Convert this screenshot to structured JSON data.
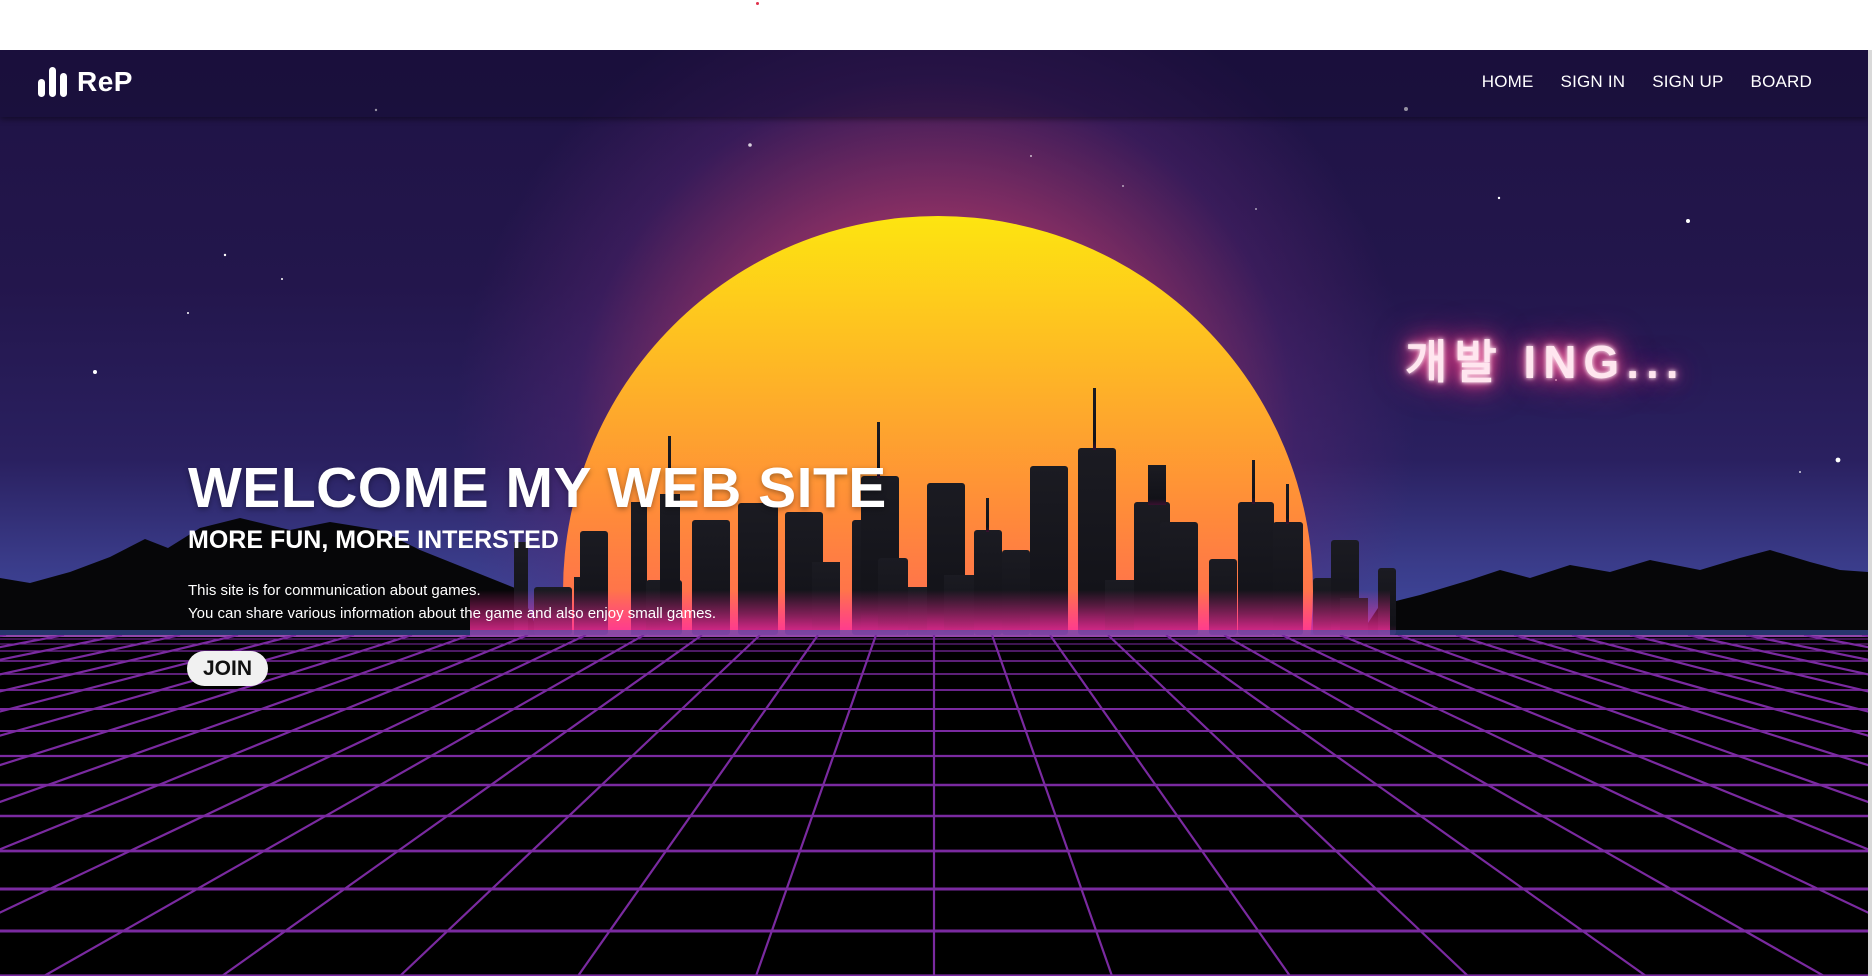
{
  "navbar": {
    "brand": "ReP",
    "links": [
      "HOME",
      "SIGN IN",
      "SIGN UP",
      "BOARD"
    ]
  },
  "neon_sign": "개발 ING...",
  "hero": {
    "title": "WELCOME MY WEB SITE",
    "subtitle": "MORE FUN, MORE INTERSTED",
    "description_line1": "This site is for communication about games.",
    "description_line2": "You can share various information about the game and also enjoy small games.",
    "join_label": "JOIN"
  },
  "colors": {
    "sky_top": "#1f1345",
    "sky_horizon": "#3f4aa0",
    "sun_top": "#fde510",
    "sun_middle": "#ff7a3f",
    "sun_bottom": "#ff1a8e",
    "grid_line": "#7a2aa0",
    "neon_glow": "#ff3c8c",
    "building": "#121218"
  },
  "icons": {
    "logo": "bar-chart-logo-icon"
  }
}
